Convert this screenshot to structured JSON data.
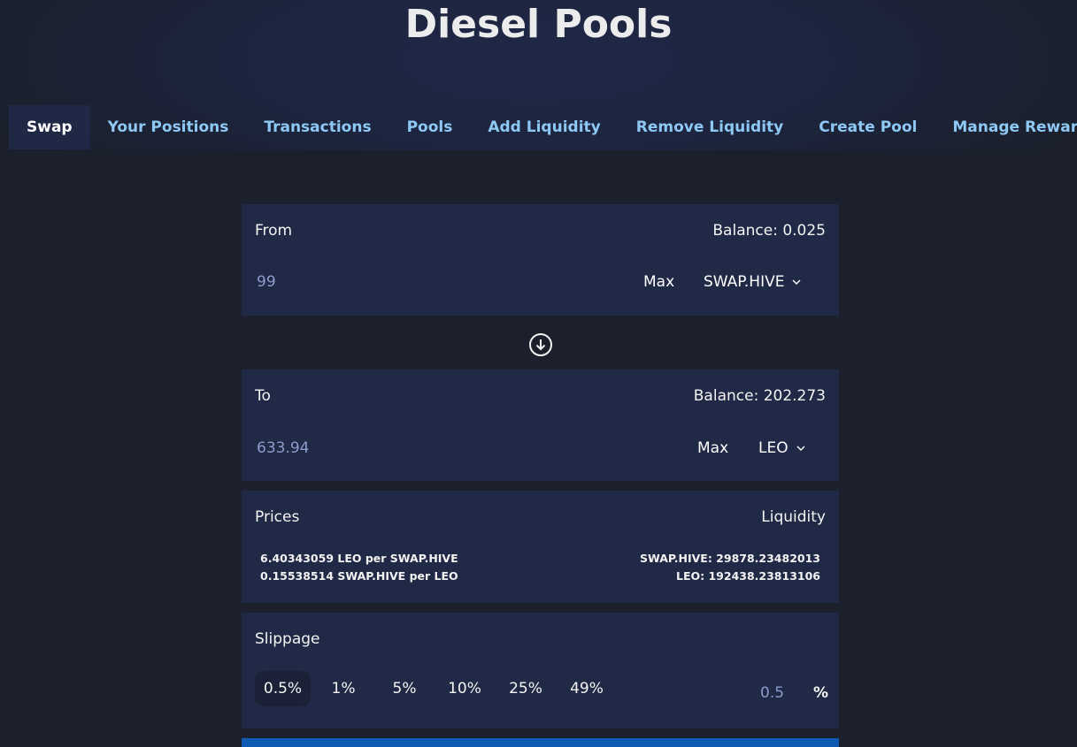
{
  "app": {
    "title": "Diesel Pools"
  },
  "nav": {
    "items": [
      {
        "label": "Swap",
        "active": true
      },
      {
        "label": "Your Positions",
        "active": false
      },
      {
        "label": "Transactions",
        "active": false
      },
      {
        "label": "Pools",
        "active": false
      },
      {
        "label": "Add Liquidity",
        "active": false
      },
      {
        "label": "Remove Liquidity",
        "active": false
      },
      {
        "label": "Create Pool",
        "active": false
      },
      {
        "label": "Manage Rewards",
        "active": false
      }
    ]
  },
  "swap": {
    "from": {
      "label": "From",
      "balance": "Balance: 0.025",
      "amount": "99",
      "max_label": "Max",
      "token": "SWAP.HIVE",
      "token_icon": "chevron-down-icon"
    },
    "switch_icon": "arrow-down-circle-icon",
    "to": {
      "label": "To",
      "balance": "Balance: 202.273",
      "amount": "633.94",
      "max_label": "Max",
      "token": "LEO",
      "token_icon": "chevron-down-icon"
    },
    "prices": {
      "label": "Prices",
      "lines": [
        "6.40343059 LEO per SWAP.HIVE",
        "0.15538514 SWAP.HIVE per LEO"
      ]
    },
    "liquidity": {
      "label": "Liquidity",
      "lines": [
        "SWAP.HIVE: 29878.23482013",
        "LEO: 192438.23813106"
      ]
    },
    "slippage": {
      "label": "Slippage",
      "options": [
        "0.5%",
        "1%",
        "5%",
        "10%",
        "25%",
        "49%"
      ],
      "selected": "0.5%",
      "custom_value": "0.5",
      "unit": "%"
    }
  },
  "colors": {
    "background": "#1b202c",
    "card": "#202945",
    "nav_link": "#8ec8f4",
    "input_text": "#8b9ccc",
    "primary_button": "#0f5ab3"
  }
}
